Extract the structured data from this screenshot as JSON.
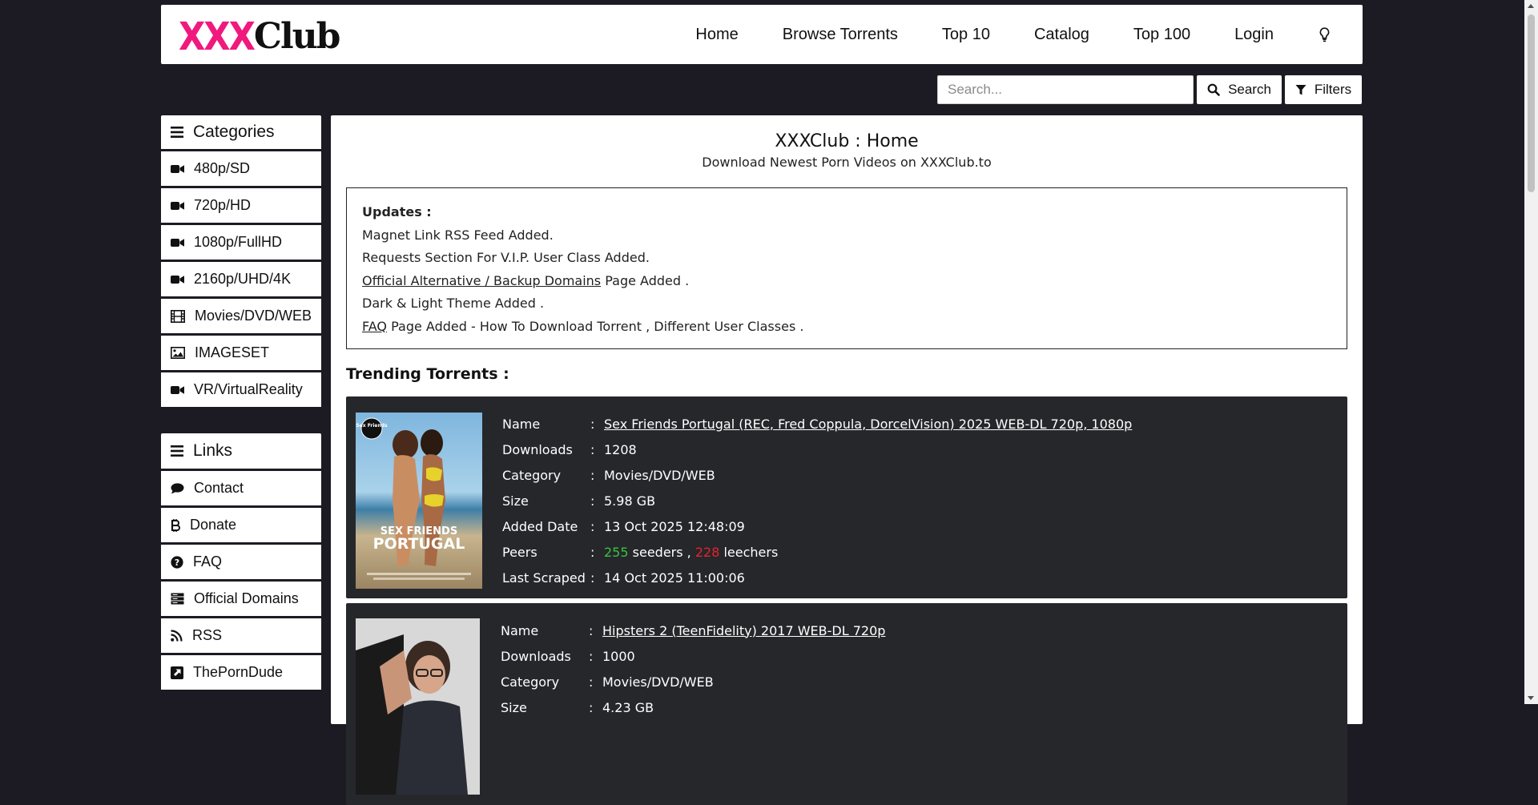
{
  "logo": {
    "part1": "XXX",
    "part2": "Club"
  },
  "nav": {
    "items": [
      "Home",
      "Browse Torrents",
      "Top 10",
      "Catalog",
      "Top 100",
      "Login"
    ],
    "theme_icon": "lightbulb-icon"
  },
  "search": {
    "placeholder": "Search...",
    "button_label": "Search",
    "filters_label": "Filters"
  },
  "categories": {
    "title": "Categories",
    "items": [
      {
        "label": "480p/SD",
        "icon": "video-camera-icon"
      },
      {
        "label": "720p/HD",
        "icon": "video-camera-icon"
      },
      {
        "label": "1080p/FullHD",
        "icon": "video-camera-icon"
      },
      {
        "label": "2160p/UHD/4K",
        "icon": "video-camera-icon"
      },
      {
        "label": "Movies/DVD/WEB",
        "icon": "film-icon"
      },
      {
        "label": "IMAGESET",
        "icon": "image-icon"
      },
      {
        "label": "VR/VirtualReality",
        "icon": "video-camera-icon"
      }
    ]
  },
  "links": {
    "title": "Links",
    "items": [
      {
        "label": "Contact",
        "icon": "comment-icon"
      },
      {
        "label": "Donate",
        "icon": "bitcoin-icon"
      },
      {
        "label": "FAQ",
        "icon": "question-circle-icon"
      },
      {
        "label": "Official Domains",
        "icon": "server-icon"
      },
      {
        "label": "RSS",
        "icon": "rss-icon"
      },
      {
        "label": "ThePornDude",
        "icon": "external-link-square-icon"
      }
    ]
  },
  "main": {
    "title": "XXXClub : Home",
    "subtitle": "Download Newest Porn Videos on XXXClub.to"
  },
  "updates": {
    "header": "Updates :",
    "line1": "Magnet Link RSS Feed Added.",
    "line2": "Requests Section For V.I.P. User Class Added.",
    "line3_link": "Official Alternative / Backup Domains",
    "line3_rest": " Page Added .",
    "line4": "Dark & Light Theme Added .",
    "line5_link": "FAQ",
    "line5_rest": " Page Added - How To Download Torrent , Different User Classes ."
  },
  "trending": {
    "title": "Trending Torrents :",
    "labels": {
      "name": "Name",
      "downloads": "Downloads",
      "category": "Category",
      "size": "Size",
      "added": "Added Date",
      "peers": "Peers",
      "scraped": "Last Scraped",
      "sep": ":",
      "seeders": " seeders , ",
      "leechers": " leechers"
    },
    "items": [
      {
        "name": "Sex Friends Portugal (REC, Fred Coppula, DorcelVision) 2025 WEB-DL 720p, 1080p",
        "downloads": "1208",
        "category": "Movies/DVD/WEB",
        "size": "5.98 GB",
        "added": "13 Oct 2025 12:48:09",
        "seeders": "255",
        "leechers": "228",
        "scraped": "14 Oct 2025 11:00:06",
        "cover_text_top": "Sex Friends",
        "cover_text_1": "SEX FRIENDS",
        "cover_text_2": "PORTUGAL"
      },
      {
        "name": "Hipsters 2 (TeenFidelity) 2017 WEB-DL 720p",
        "downloads": "1000",
        "category": "Movies/DVD/WEB",
        "size": "4.23 GB"
      }
    ]
  }
}
